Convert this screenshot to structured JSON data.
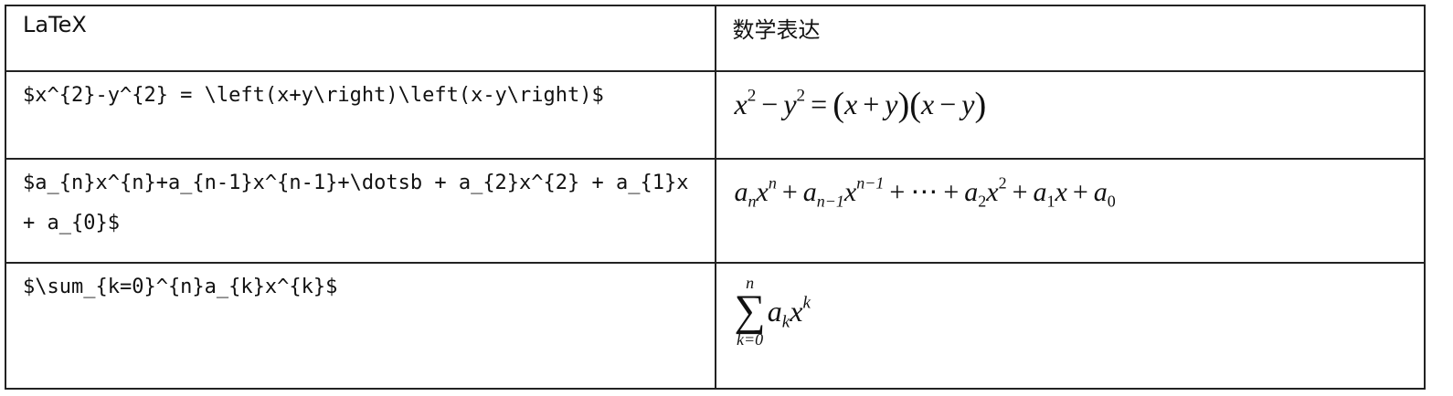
{
  "table": {
    "headers": {
      "latex": "LaTeX",
      "math": "数学表达"
    },
    "rows": [
      {
        "latex": "$x^{2}-y^{2} = \\left(x+y\\right)\\left(x-y\\right)$",
        "math": "x² − y² = (x + y)(x − y)"
      },
      {
        "latex": "$a_{n}x^{n}+a_{n-1}x^{n-1}+\\dotsb + a_{2}x^{2} + a_{1}x + a_{0}$",
        "math": "aₙxⁿ + aₙ₋₁xⁿ⁻¹ + ⋯ + a₂x² + a₁x + a₀"
      },
      {
        "latex": "$\\sum_{k=0}^{n}a_{k}x^{k}$",
        "math": "∑ₖ₌₀ⁿ aₖxᵏ"
      }
    ]
  }
}
